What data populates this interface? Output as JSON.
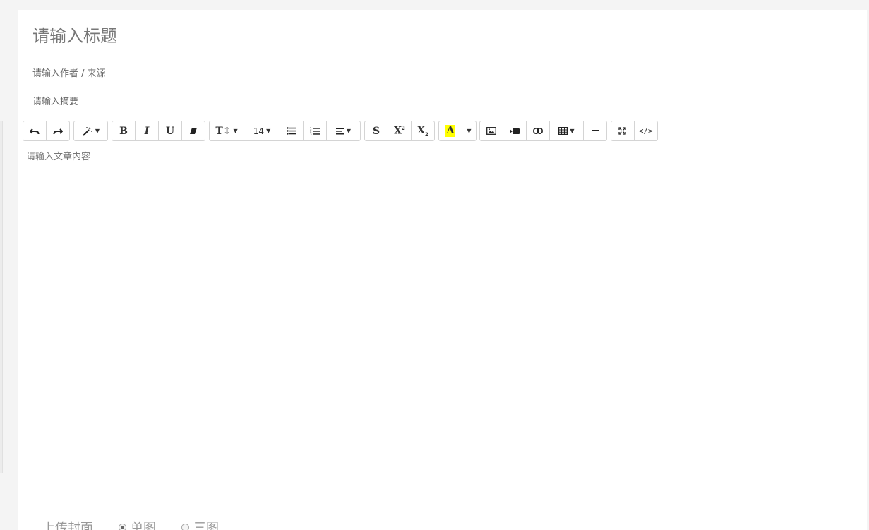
{
  "form": {
    "title_placeholder": "请输入标题",
    "author_placeholder": "请输入作者 / 来源",
    "summary_placeholder": "请输入摘要",
    "content_placeholder": "请输入文章内容"
  },
  "toolbar": {
    "font_size_value": "14"
  },
  "cover": {
    "label": "上传封面",
    "options": [
      {
        "label": "单图",
        "checked": true
      },
      {
        "label": "三图",
        "checked": false
      }
    ]
  },
  "colors": {
    "highlight": "#ffff00",
    "border": "#d4d4d4"
  }
}
